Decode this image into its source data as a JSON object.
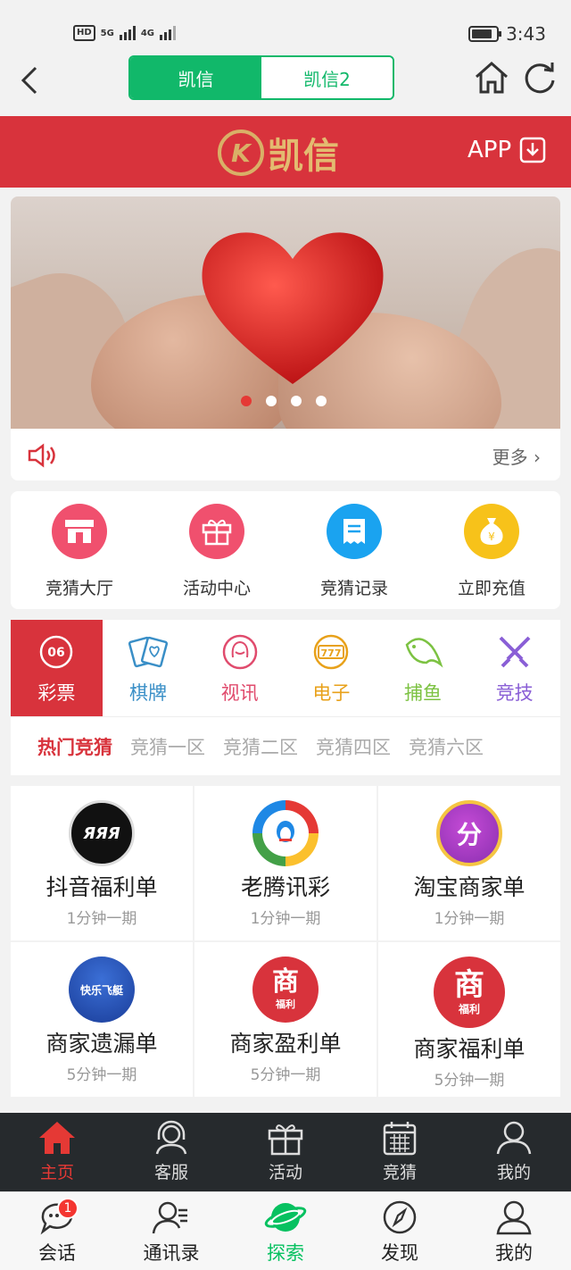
{
  "status_bar": {
    "time": "3:43",
    "hd": "HD",
    "signal1": "5G",
    "signal2": "4G"
  },
  "nav": {
    "tabs": [
      {
        "label": "凯信"
      },
      {
        "label": "凯信2"
      }
    ]
  },
  "header": {
    "logo_text": "凯信",
    "logo_badge": "K",
    "app_label": "APP"
  },
  "slider": {
    "slides": 4,
    "active_slide": 1
  },
  "notice": {
    "more_label": "更多"
  },
  "quick_actions": [
    {
      "label": "竞猜大厅",
      "icon": "lottery-shop-icon",
      "color": "#f0506e"
    },
    {
      "label": "活动中心",
      "icon": "gift-icon",
      "color": "#f0506e"
    },
    {
      "label": "竞猜记录",
      "icon": "receipt-icon",
      "color": "#1aa3f0"
    },
    {
      "label": "立即充值",
      "icon": "money-bag-icon",
      "color": "#f7c21a"
    }
  ],
  "categories": [
    {
      "label": "彩票",
      "icon": "lottery-ball-icon",
      "badge": "06",
      "color": "#ffffff"
    },
    {
      "label": "棋牌",
      "icon": "cards-icon",
      "color": "#3a8fc7"
    },
    {
      "label": "视讯",
      "icon": "live-dealer-icon",
      "color": "#e04b6d"
    },
    {
      "label": "电子",
      "icon": "slot-777-icon",
      "color": "#e8a11a"
    },
    {
      "label": "捕鱼",
      "icon": "fish-icon",
      "color": "#7cc242"
    },
    {
      "label": "竞技",
      "icon": "crossed-swords-icon",
      "color": "#8a5fd6"
    }
  ],
  "sub_tabs": [
    {
      "label": "热门竞猜"
    },
    {
      "label": "竞猜一区"
    },
    {
      "label": "竞猜二区"
    },
    {
      "label": "竞猜四区"
    },
    {
      "label": "竞猜六区"
    }
  ],
  "games": [
    {
      "name": "抖音福利单",
      "period": "1分钟一期",
      "icon_text": "ЯЯЯ"
    },
    {
      "name": "老腾讯彩",
      "period": "1分钟一期",
      "icon_text": ""
    },
    {
      "name": "淘宝商家单",
      "period": "1分钟一期",
      "icon_text": "分"
    },
    {
      "name": "商家遗漏单",
      "period": "5分钟一期",
      "icon_text": "快乐飞艇"
    },
    {
      "name": "商家盈利单",
      "period": "5分钟一期",
      "icon_text": "商",
      "icon_sub": "福利"
    },
    {
      "name": "商家福利单",
      "period": "5分钟一期",
      "icon_text": "商",
      "icon_sub": "福利"
    }
  ],
  "inner_tabs": [
    {
      "label": "主页",
      "icon": "home-icon"
    },
    {
      "label": "客服",
      "icon": "headset-icon"
    },
    {
      "label": "活动",
      "icon": "gift-icon"
    },
    {
      "label": "竞猜",
      "icon": "calendar-icon"
    },
    {
      "label": "我的",
      "icon": "user-icon"
    }
  ],
  "wx_tabs": [
    {
      "label": "会话",
      "icon": "chat-icon",
      "badge": "1"
    },
    {
      "label": "通讯录",
      "icon": "contacts-icon"
    },
    {
      "label": "探索",
      "icon": "planet-icon"
    },
    {
      "label": "发现",
      "icon": "compass-icon"
    },
    {
      "label": "我的",
      "icon": "user-icon"
    }
  ]
}
